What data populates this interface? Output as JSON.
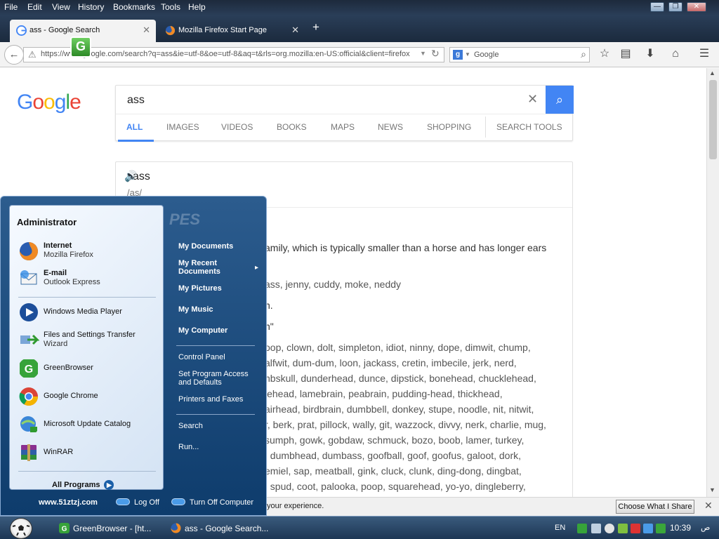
{
  "menubar": {
    "items": [
      "File",
      "Edit",
      "View",
      "History",
      "Bookmarks",
      "Tools",
      "Help"
    ],
    "window_buttons": {
      "minimize": "—",
      "restore": "❐",
      "close": "✕"
    }
  },
  "tabs": [
    {
      "title": "ass - Google Search",
      "icon": "google-g-icon",
      "close": "✕"
    },
    {
      "title": "Mozilla Firefox Start Page",
      "icon": "firefox-icon",
      "close": "✕"
    }
  ],
  "new_tab_label": "+",
  "navbar": {
    "url": "https://www.google.com/search?q=ass&ie=utf-8&oe=utf-8&aq=t&rls=org.mozilla:en-US:official&client=firefox",
    "search_placeholder": "Google",
    "search_engine_glyph": "g"
  },
  "google": {
    "logo_letters": [
      {
        "ch": "G",
        "color": "#4285f4"
      },
      {
        "ch": "o",
        "color": "#ea4335"
      },
      {
        "ch": "o",
        "color": "#fbbc05"
      },
      {
        "ch": "g",
        "color": "#4285f4"
      },
      {
        "ch": "l",
        "color": "#34a853"
      },
      {
        "ch": "e",
        "color": "#ea4335"
      }
    ],
    "query": "ass",
    "tabs": [
      "ALL",
      "IMAGES",
      "VIDEOS",
      "BOOKS",
      "MAPS",
      "NEWS",
      "SHOPPING",
      "SEARCH TOOLS"
    ],
    "active_tab": "ALL",
    "dict_word": "ass",
    "dict_pron": "/as/",
    "dict_lines": [
      "amily, which is typically smaller than a horse and has longer ears",
      "ass, jenny, cuddy, moke, neddy",
      "n.",
      "n\"",
      "oop, clown, dolt, simpleton, idiot, ninny, dope, dimwit, chump,",
      "alfwit, dum-dum, loon, jackass, cretin, imbecile, jerk, nerd,",
      "nbskull, dunderhead, dunce, dipstick, bonehead, chucklehead,",
      "lehead, lamebrain, peabrain, pudding-head, thickhead,",
      "airhead, birdbrain, dumbbell, donkey, stupe, noodle, nit, nitwit,",
      "r, berk, prat, pillock, wally, git, wazzock, divvy, nerk, charlie, mug,",
      "sumph, gowk, gobdaw, schmuck, bozo, boob, lamer, turkey,",
      ", dumbhead, dumbass, goofball, goof, goofus, galoot, dork,",
      "emiel, sap, meatball, gink, cluck, clunk, ding-dong, dingbat,",
      ", spud, coot, palooka, poop, squarehead, yo-yo, dingleberry,"
    ]
  },
  "notification": {
    "message": "your experience.",
    "button": "Choose What I Share",
    "close": "✕"
  },
  "start_menu": {
    "user": "Administrator",
    "pinned": [
      {
        "title": "Internet",
        "sub": "Mozilla Firefox",
        "icon": "firefox-icon"
      },
      {
        "title": "E-mail",
        "sub": "Outlook Express",
        "icon": "outlook-express-icon"
      }
    ],
    "recent": [
      {
        "title": "Windows Media Player",
        "icon": "media-player-icon"
      },
      {
        "title": "Files and Settings Transfer",
        "sub": "Wizard",
        "icon": "transfer-wizard-icon"
      },
      {
        "title": "GreenBrowser",
        "icon": "greenbrowser-icon"
      },
      {
        "title": "Google Chrome",
        "icon": "chrome-icon"
      },
      {
        "title": "Microsoft Update Catalog",
        "icon": "update-catalog-icon"
      },
      {
        "title": "WinRAR",
        "icon": "winrar-icon"
      }
    ],
    "all_programs": "All Programs",
    "right_bold": [
      "My Documents",
      "My Recent Documents",
      "My Pictures",
      "My Music",
      "My Computer"
    ],
    "right_plain": [
      "Control Panel",
      "Set Program Access and Defaults",
      "Printers and Faxes"
    ],
    "right_bottom": [
      "Search",
      "Run..."
    ],
    "submenu_arrow": "▸",
    "banner": "PES",
    "site": "www.51ztzj.com",
    "log_off": "Log Off",
    "turn_off": "Turn Off Computer"
  },
  "taskbar": {
    "tasks": [
      {
        "label": "GreenBrowser - [ht...",
        "icon": "greenbrowser-icon"
      },
      {
        "label": "ass - Google Search...",
        "icon": "firefox-icon"
      }
    ],
    "lang": "EN",
    "clock": "10:39",
    "ampm": "ص"
  }
}
